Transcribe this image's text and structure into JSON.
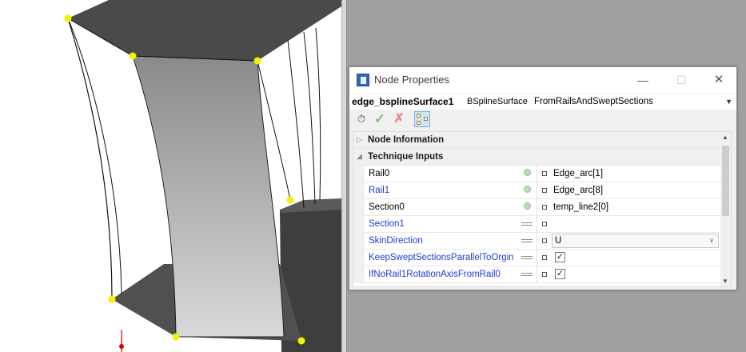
{
  "dialog": {
    "title": "Node Properties",
    "window_buttons": {
      "minimize": "—",
      "maximize": "☐",
      "close": "✕"
    }
  },
  "node": {
    "name": "edge_bsplineSurface1",
    "type": "BSplineSurface",
    "technique": "FromRailsAndSweptSections"
  },
  "toolbar": {
    "icons": [
      "run-icon",
      "apply-check-icon",
      "cancel-x-icon",
      "graph-view-icon"
    ]
  },
  "property_grid": {
    "categories": [
      {
        "label": "Node Information",
        "expanded": false
      },
      {
        "label": "Technique Inputs",
        "expanded": true
      }
    ],
    "rows": [
      {
        "name": "Rail0",
        "value": "Edge_arc[1]",
        "required": true
      },
      {
        "name": "Rail1",
        "value": "Edge_arc[8]",
        "required": false
      },
      {
        "name": "Section0",
        "value": "temp_line2[0]",
        "required": true
      },
      {
        "name": "Section1",
        "value": "",
        "required": false
      },
      {
        "name": "SkinDirection",
        "value": "U",
        "required": false
      },
      {
        "name": "KeepSweptSectionsParallelToOrgin",
        "value": "✓",
        "required": false
      },
      {
        "name": "IfNoRail1RotationAxisFromRail0",
        "value": "✓",
        "required": false
      }
    ]
  },
  "colors": {
    "viewport_bg": "#ffffff",
    "surface_gray": "#a8a8a8",
    "dark_face": "#4a4a4a",
    "control_point": "#f5f000",
    "blue_label": "#1e3ccf",
    "workspace_bg": "#a0a0a0"
  }
}
